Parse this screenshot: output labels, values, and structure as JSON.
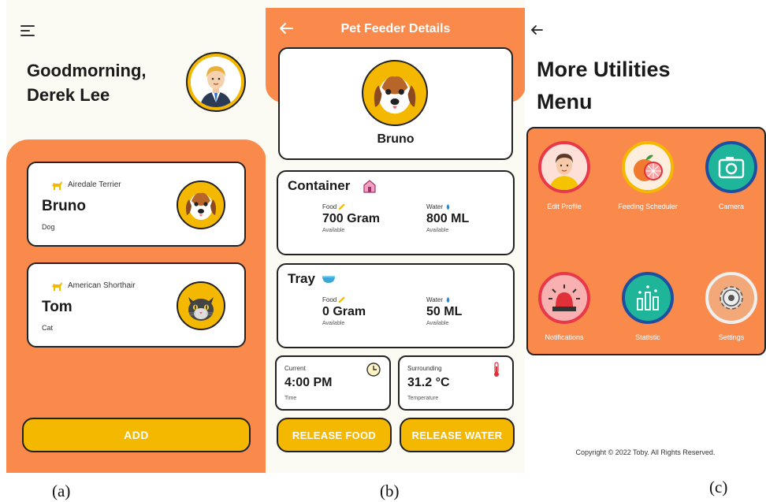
{
  "panel_a": {
    "greeting_line1": "Goodmorning,",
    "greeting_line2": "Derek Lee",
    "pets": [
      {
        "breed": "Airedale Terrier",
        "name": "Bruno",
        "type": "Dog",
        "avatar": "dog-icon"
      },
      {
        "breed": "American Shorthair",
        "name": "Tom",
        "type": "Cat",
        "avatar": "cat-icon"
      }
    ],
    "add_label": "ADD"
  },
  "panel_b": {
    "title": "Pet Feeder Details",
    "pet_name": "Bruno",
    "container": {
      "title": "Container",
      "food_label": "Food",
      "food_value": "700 Gram",
      "food_sub": "Available",
      "water_label": "Water",
      "water_value": "800 ML",
      "water_sub": "Available"
    },
    "tray": {
      "title": "Tray",
      "food_label": "Food",
      "food_value": "0 Gram",
      "food_sub": "Available",
      "water_label": "Water",
      "water_value": "50 ML",
      "water_sub": "Available"
    },
    "time": {
      "label": "Current",
      "value": "4:00 PM",
      "sub": "Time"
    },
    "temp": {
      "label": "Surrounding",
      "value": "31.2 °C",
      "sub": "Temperature"
    },
    "release_food": "RELEASE FOOD",
    "release_water": "RELEASE WATER"
  },
  "panel_c": {
    "title_line1": "More Utilities",
    "title_line2": "Menu",
    "utilities": [
      {
        "label": "Edit Profile",
        "icon": "profile-icon",
        "ring": "#e8394a"
      },
      {
        "label": "Feeding Scheduler",
        "icon": "grapefruit-icon",
        "ring": "#f5b800"
      },
      {
        "label": "Camera",
        "icon": "camera-icon",
        "ring": "#1f4fa0"
      },
      {
        "label": "Notifications",
        "icon": "alarm-icon",
        "ring": "#e8394a"
      },
      {
        "label": "Statistic",
        "icon": "chart-icon",
        "ring": "#1f4fa0"
      },
      {
        "label": "Settings",
        "icon": "gear-icon",
        "ring": "#f0f0f0"
      }
    ],
    "copyright": "Copyright © 2022 Toby. All Rights Reserved."
  },
  "captions": [
    "(a)",
    "(b)",
    "(c)"
  ],
  "colors": {
    "orange": "#fa8a4c",
    "yellow": "#f5b800",
    "outline": "#222222"
  }
}
